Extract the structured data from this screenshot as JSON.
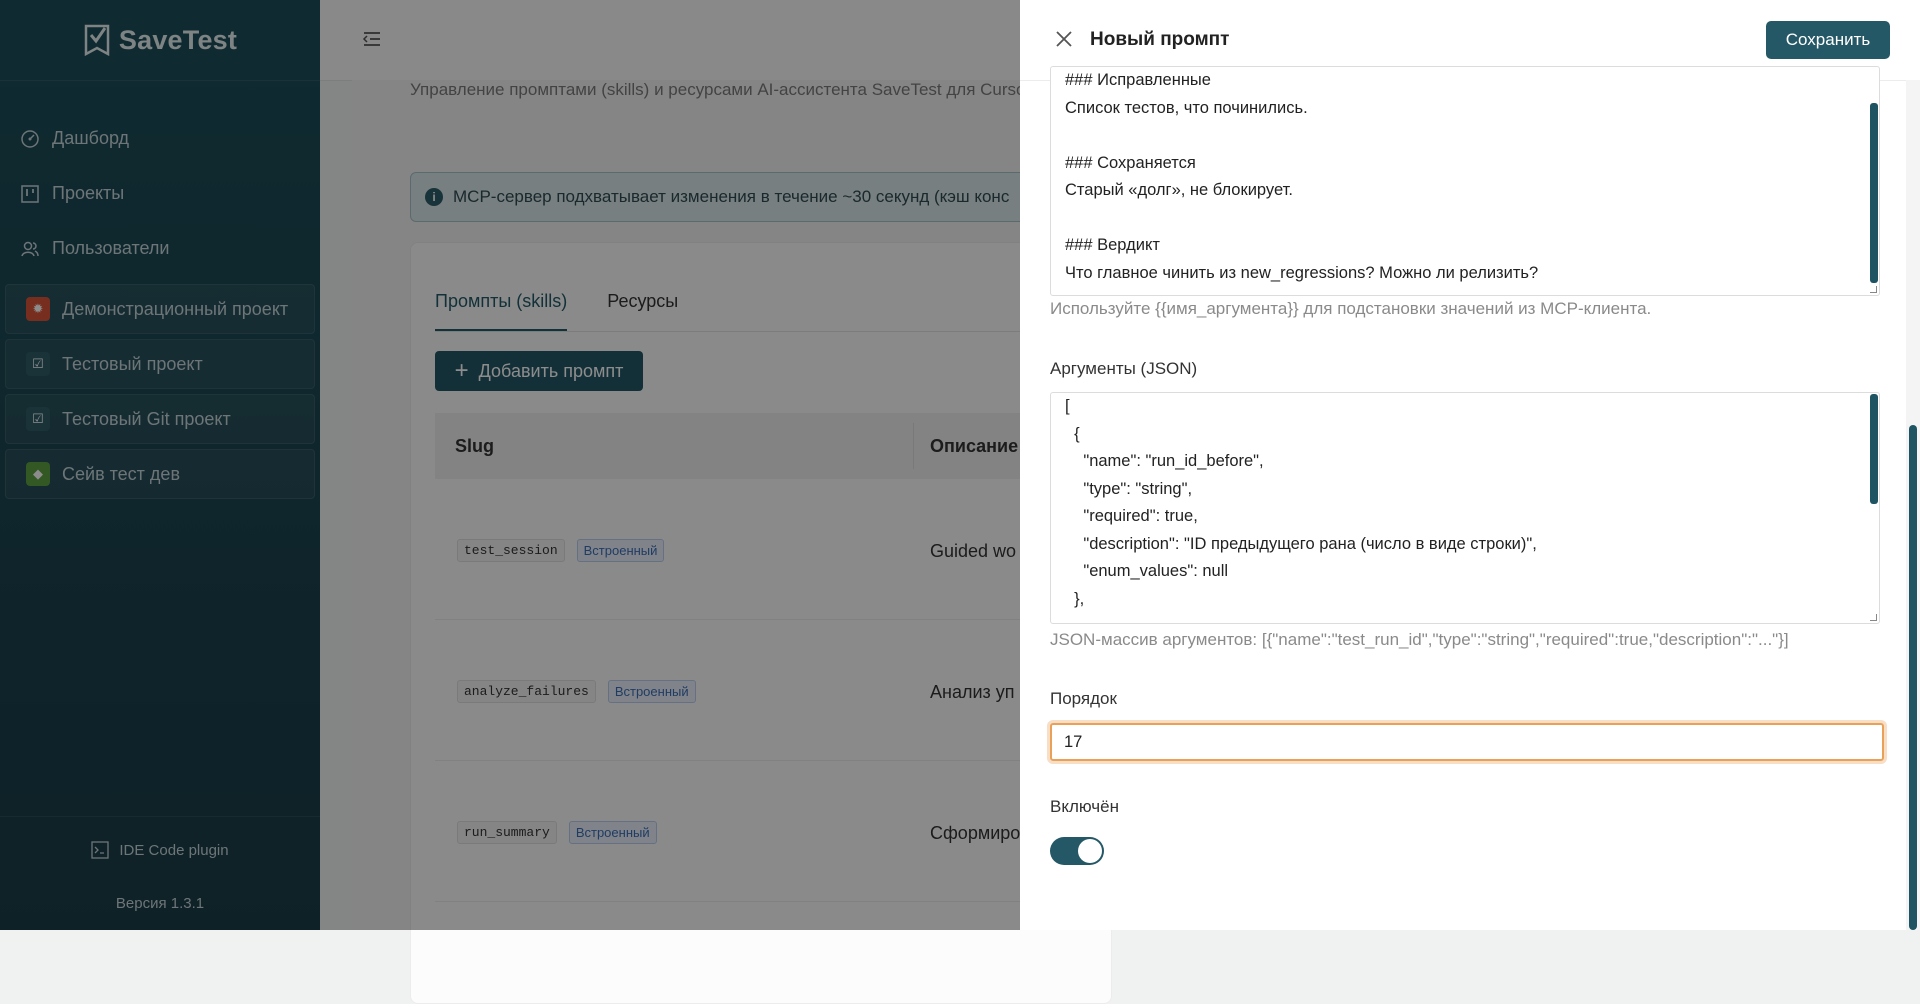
{
  "sidebar": {
    "logo_text": "SaveTest",
    "nav": [
      {
        "label": "Дашборд",
        "icon": "dashboard-icon"
      },
      {
        "label": "Проекты",
        "icon": "kanban-icon"
      },
      {
        "label": "Пользователи",
        "icon": "users-icon"
      }
    ],
    "projects": [
      {
        "label": "Демонстрационный проект",
        "icon": "bug-icon",
        "color": "#d9553a"
      },
      {
        "label": "Тестовый проект",
        "icon": "checklist-icon",
        "color": "#2e5d69"
      },
      {
        "label": "Тестовый Git проект",
        "icon": "checklist-icon",
        "color": "#2e5d69"
      },
      {
        "label": "Сейв тест дев",
        "icon": "android-icon",
        "color": "#5fa043"
      }
    ],
    "plugin_label": "IDE Code plugin",
    "version": "Версия 1.3.1"
  },
  "main": {
    "subtitle": "Управление промптами (skills) и ресурсами AI-ассистента SaveTest для Curso",
    "banner": "MCP-сервер подхватывает изменения в течение ~30 секунд (кэш конс",
    "tabs": [
      "Промпты (skills)",
      "Ресурсы"
    ],
    "add_button": "Добавить промпт",
    "columns": {
      "slug": "Slug",
      "description": "Описание"
    },
    "rows": [
      {
        "slug": "test_session",
        "badge": "Встроенный",
        "description": "Guided wo"
      },
      {
        "slug": "analyze_failures",
        "badge": "Встроенный",
        "description": "Анализ уп"
      },
      {
        "slug": "run_summary",
        "badge": "Встроенный",
        "description": "Сформиро"
      }
    ]
  },
  "drawer": {
    "title": "Новый промпт",
    "save_button": "Сохранить",
    "template_lines": [
      "### Исправленные",
      "Список тестов, что починились.",
      "",
      "### Сохраняется",
      "Старый «долг», не блокирует.",
      "",
      "### Вердикт",
      "Что главное чинить из new_regressions? Можно ли релизить?"
    ],
    "template_hint": "Используйте {{имя_аргумента}} для подстановки значений из MCP-клиента.",
    "args_label": "Аргументы (JSON)",
    "args_lines": [
      "[",
      "  {",
      "    \"name\": \"run_id_before\",",
      "    \"type\": \"string\",",
      "    \"required\": true,",
      "    \"description\": \"ID предыдущего рана (число в виде строки)\",",
      "    \"enum_values\": null",
      "  },"
    ],
    "args_hint": "JSON-массив аргументов: [{\"name\":\"test_run_id\",\"type\":\"string\",\"required\":true,\"description\":\"...\"}]",
    "order_label": "Порядок",
    "order_value": "17",
    "enabled_label": "Включён",
    "enabled": true
  }
}
